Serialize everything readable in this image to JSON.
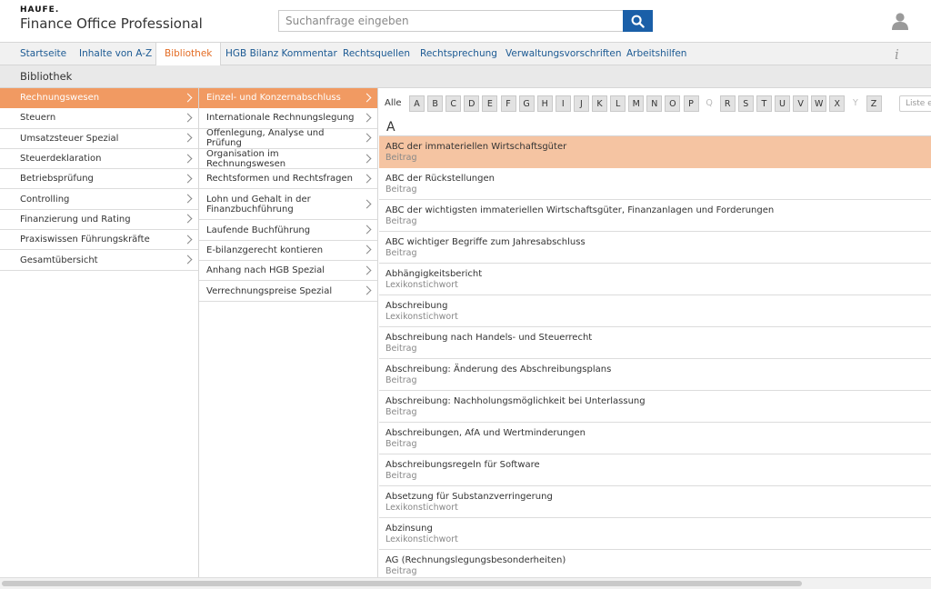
{
  "header": {
    "logo_mark": "HAUFE.",
    "app_title": "Finance Office Professional",
    "search_placeholder": "Suchanfrage eingeben"
  },
  "nav": {
    "items": [
      {
        "label": "Startseite"
      },
      {
        "label": "Inhalte von A-Z"
      },
      {
        "label": "Bibliothek",
        "active": true
      },
      {
        "label": "HGB Bilanz Kommentar"
      },
      {
        "label": "Rechtsquellen"
      },
      {
        "label": "Rechtsprechung"
      },
      {
        "label": "Verwaltungsvorschriften"
      },
      {
        "label": "Arbeitshilfen"
      }
    ],
    "info_label": "i"
  },
  "section": {
    "title": "Bibliothek"
  },
  "categories": [
    {
      "label": "Rechnungswesen",
      "active": true
    },
    {
      "label": "Steuern"
    },
    {
      "label": "Umsatzsteuer Spezial"
    },
    {
      "label": "Steuerdeklaration"
    },
    {
      "label": "Betriebsprüfung"
    },
    {
      "label": "Controlling"
    },
    {
      "label": "Finanzierung und Rating"
    },
    {
      "label": "Praxiswissen Führungskräfte"
    },
    {
      "label": "Gesamtübersicht"
    }
  ],
  "subcategories": [
    {
      "label": "Einzel- und Konzernabschluss",
      "active": true
    },
    {
      "label": "Internationale Rechnungslegung"
    },
    {
      "label": "Offenlegung, Analyse und Prüfung"
    },
    {
      "label": "Organisation im Rechnungswesen"
    },
    {
      "label": "Rechtsformen und Rechtsfragen"
    },
    {
      "label": "Lohn und Gehalt in der Finanzbuchführung",
      "tall": true
    },
    {
      "label": "Laufende Buchführung"
    },
    {
      "label": "E-bilanzgerecht kontieren"
    },
    {
      "label": "Anhang nach HGB Spezial"
    },
    {
      "label": "Verrechnungspreise Spezial"
    }
  ],
  "alphabet": {
    "all_label": "Alle",
    "letters": [
      {
        "l": "A"
      },
      {
        "l": "B"
      },
      {
        "l": "C"
      },
      {
        "l": "D"
      },
      {
        "l": "E"
      },
      {
        "l": "F"
      },
      {
        "l": "G"
      },
      {
        "l": "H"
      },
      {
        "l": "I"
      },
      {
        "l": "J"
      },
      {
        "l": "K"
      },
      {
        "l": "L"
      },
      {
        "l": "M"
      },
      {
        "l": "N"
      },
      {
        "l": "O"
      },
      {
        "l": "P"
      },
      {
        "l": "Q",
        "disabled": true
      },
      {
        "l": "R"
      },
      {
        "l": "S"
      },
      {
        "l": "T"
      },
      {
        "l": "U"
      },
      {
        "l": "V"
      },
      {
        "l": "W"
      },
      {
        "l": "X"
      },
      {
        "l": "Y",
        "disabled": true
      },
      {
        "l": "Z"
      }
    ],
    "filter_placeholder": "Liste ei"
  },
  "current_letter": "A",
  "results": [
    {
      "title": "ABC der immateriellen Wirtschaftsgüter",
      "type": "Beitrag",
      "active": true
    },
    {
      "title": "ABC der Rückstellungen",
      "type": "Beitrag"
    },
    {
      "title": "ABC der wichtigsten immateriellen Wirtschaftsgüter, Finanzanlagen und Forderungen",
      "type": "Beitrag"
    },
    {
      "title": "ABC wichtiger Begriffe zum Jahresabschluss",
      "type": "Beitrag"
    },
    {
      "title": "Abhängigkeitsbericht",
      "type": "Lexikonstichwort"
    },
    {
      "title": "Abschreibung",
      "type": "Lexikonstichwort"
    },
    {
      "title": "Abschreibung nach Handels- und Steuerrecht",
      "type": "Beitrag"
    },
    {
      "title": "Abschreibung: Änderung des Abschreibungsplans",
      "type": "Beitrag"
    },
    {
      "title": "Abschreibung: Nachholungsmöglichkeit bei Unterlassung",
      "type": "Beitrag"
    },
    {
      "title": "Abschreibungen, AfA und Wertminderungen",
      "type": "Beitrag"
    },
    {
      "title": "Abschreibungsregeln für Software",
      "type": "Beitrag"
    },
    {
      "title": "Absetzung für Substanzverringerung",
      "type": "Lexikonstichwort"
    },
    {
      "title": "Abzinsung",
      "type": "Lexikonstichwort"
    },
    {
      "title": "AG (Rechnungslegungsbesonderheiten)",
      "type": "Beitrag"
    }
  ],
  "colors": {
    "accent_orange": "#f19a62",
    "selected_row": "#f5c4a2",
    "nav_blue": "#1c5a93",
    "search_button": "#1a5fa8"
  }
}
